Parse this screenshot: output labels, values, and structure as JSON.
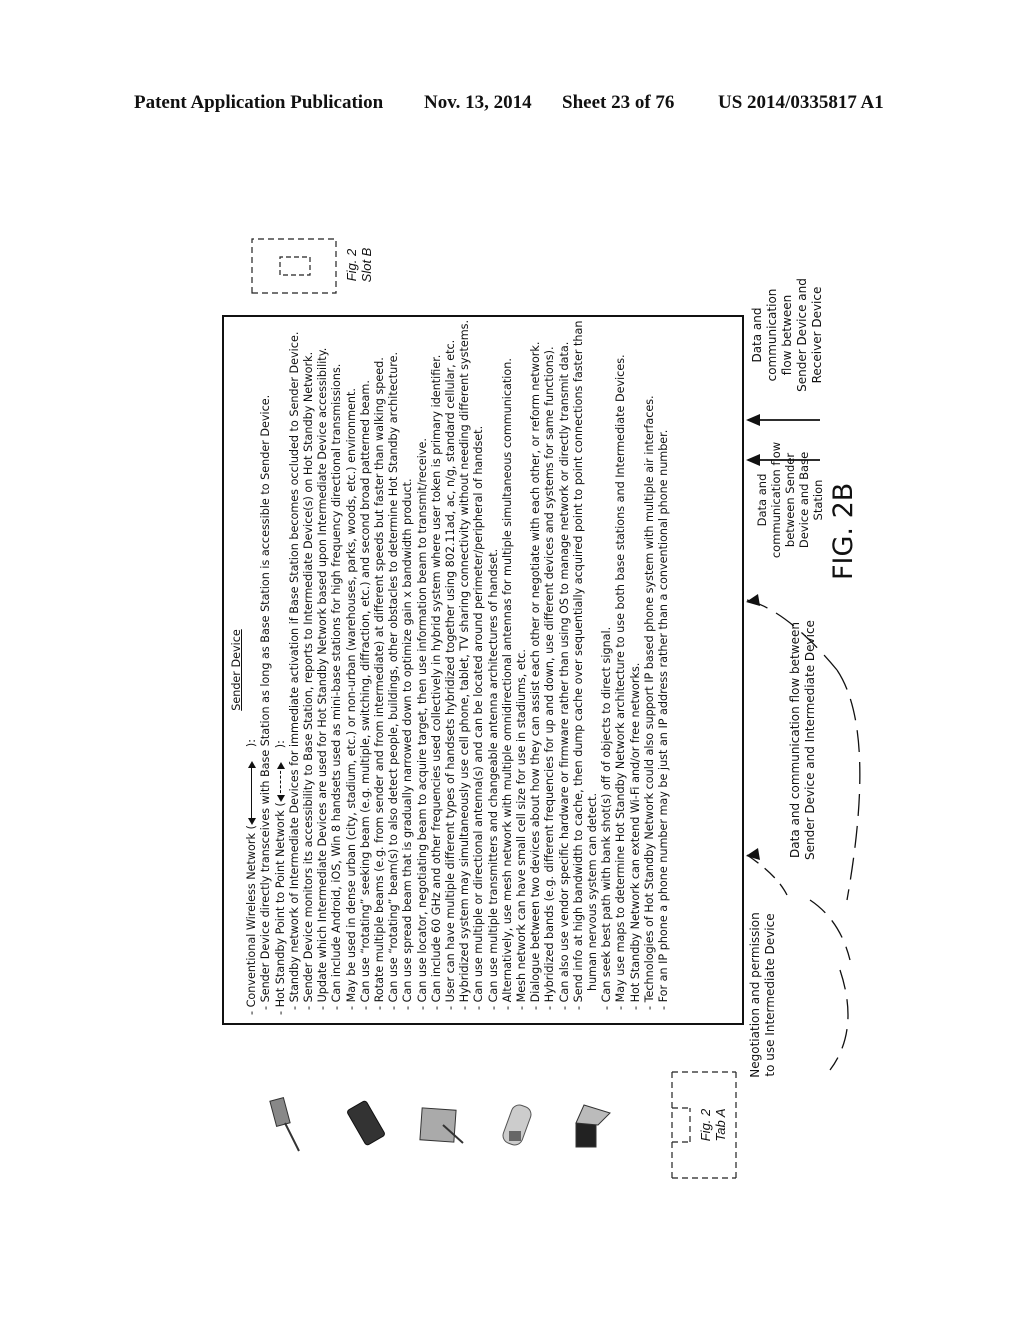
{
  "header": {
    "publication": "Patent Application Publication",
    "date": "Nov. 13, 2014",
    "sheet": "Sheet 23 of 76",
    "number": "US 2014/0335817 A1"
  },
  "box": {
    "title": "Sender Device",
    "lines": [
      {
        "level": 1,
        "text": "- Conventional Wireless Network (",
        "arrow": "solid",
        "after": "):"
      },
      {
        "level": 2,
        "text": "- Sender Device directly transceives with Base Station as long as Base Station is accessible to Sender Device."
      },
      {
        "level": 1,
        "text": "- Hot Standby Point to Point Network (",
        "arrow": "dashed",
        "after": "):"
      },
      {
        "level": 2,
        "text": "- Standby network of Intermediate Devices for immediate activation if Base Station becomes occluded to Sender Device."
      },
      {
        "level": 2,
        "text": "- Sender Device monitors its accessibility to Base Station, reports to Intermediate Device(s) on Hot Standby Network."
      },
      {
        "level": 2,
        "text": "- Update which Intermediate Devices are used for Hot Standby Network based upon Intermediate Device accessibility."
      },
      {
        "level": 2,
        "text": "- Can include Android, iOS, Win 8 handsets used as mini-base stations for high frequency directional transmissions."
      },
      {
        "level": 2,
        "text": "- May be used in dense urban (city, stadium, etc.) or non-urban (warehouses, parks, woods, etc.) environment."
      },
      {
        "level": 2,
        "text": "- Can use “rotating” seeking beam (e.g. multiple, switching, diffraction, etc.) and second broad patterned beam."
      },
      {
        "level": 2,
        "text": "- Rotate multiple beams (e.g. from sender and from intermediate) at different speeds but faster than walking speed."
      },
      {
        "level": 2,
        "text": "- Can use “rotating” beam(s) to also detect people, buildings, other obstacles to determine Hot Standby architecture."
      },
      {
        "level": 2,
        "text": "- Can use spread beam that is gradually narrowed down to optimize gain x bandwidth product."
      },
      {
        "level": 2,
        "text": "- Can use locator, negotiating beam to acquire target, then use information beam to transmit/receive."
      },
      {
        "level": 2,
        "text": "- Can include 60 GHz and other frequencies used collectively in hybrid system where user token is primary identifier."
      },
      {
        "level": 2,
        "text": "- User can have multiple different types of handsets hybridized together using 802.11ad, ac, n/g, standard cellular, etc."
      },
      {
        "level": 2,
        "text": "- Hybridized system may simultaneously use cell phone, tablet, TV sharing connectivity without needing different systems."
      },
      {
        "level": 2,
        "text": "- Can use multiple or directional antenna(s) and can be located around perimeter/peripheral of handset."
      },
      {
        "level": 2,
        "text": "- Can use multiple transmitters and changeable antenna architectures of handset."
      },
      {
        "level": 2,
        "text": "- Alternatively, use mesh network with multiple omnidirectional antennas for multiple simultaneous communication."
      },
      {
        "level": 2,
        "text": "- Mesh network can have small cell size for use in stadiums, etc."
      },
      {
        "level": 2,
        "text": "- Dialogue between two devices about how they can assist each other or negotiate with each other, or reform network."
      },
      {
        "level": 2,
        "text": "- Hybridized bands (e.g. different frequencies for up and down, use different devices and systems for same functions)."
      },
      {
        "level": 2,
        "text": "- Can also use vendor specific hardware or firmware rather than using OS to manage network or directly transmit data."
      },
      {
        "level": 2,
        "text": "- Send info at high bandwidth to cache, then dump cache over sequentially acquired point to point connections faster than"
      },
      {
        "level": 3,
        "text": "human nervous system can detect."
      },
      {
        "level": 2,
        "text": "- Can seek best path with bank shot(s) off of objects to direct signal."
      },
      {
        "level": 2,
        "text": "- May use maps to determine Hot Standby Network architecture to use both base stations and Intermediate Devices."
      },
      {
        "level": 2,
        "text": "- Hot Standby Network can extend Wi-Fi and/or free networks."
      },
      {
        "level": 2,
        "text": "- Technologies of Hot Standby Network could also support IP based phone system with multiple air interfaces."
      },
      {
        "level": 2,
        "text": "- For an IP phone a phone number may be just an IP address rather than a conventional phone number."
      }
    ]
  },
  "devices": [
    {
      "name": "laptop-icon"
    },
    {
      "name": "flip-phone-icon"
    },
    {
      "name": "tablet-with-stylus-icon"
    },
    {
      "name": "smartphone-icon"
    },
    {
      "name": "walkie-talkie-icon"
    }
  ],
  "tab_a": {
    "line1": "Fig. 2",
    "line2": "Tab A"
  },
  "slot_b": {
    "line1": "Fig. 2",
    "line2": "Slot B"
  },
  "labels": {
    "negotiation": [
      "Negotiation and permission",
      "to use Intermediate Device"
    ],
    "intermediate_flow": [
      "Data and communication flow between",
      "Sender Device and Intermediate Device"
    ],
    "base_station_flow": [
      "Data and",
      "communication flow",
      "between Sender",
      "Device and Base",
      "Station"
    ],
    "receiver_flow": [
      "Data and",
      "communication",
      "flow between",
      "Sender Device and",
      "Receiver Device"
    ]
  },
  "figure_label": "FIG. 2B"
}
